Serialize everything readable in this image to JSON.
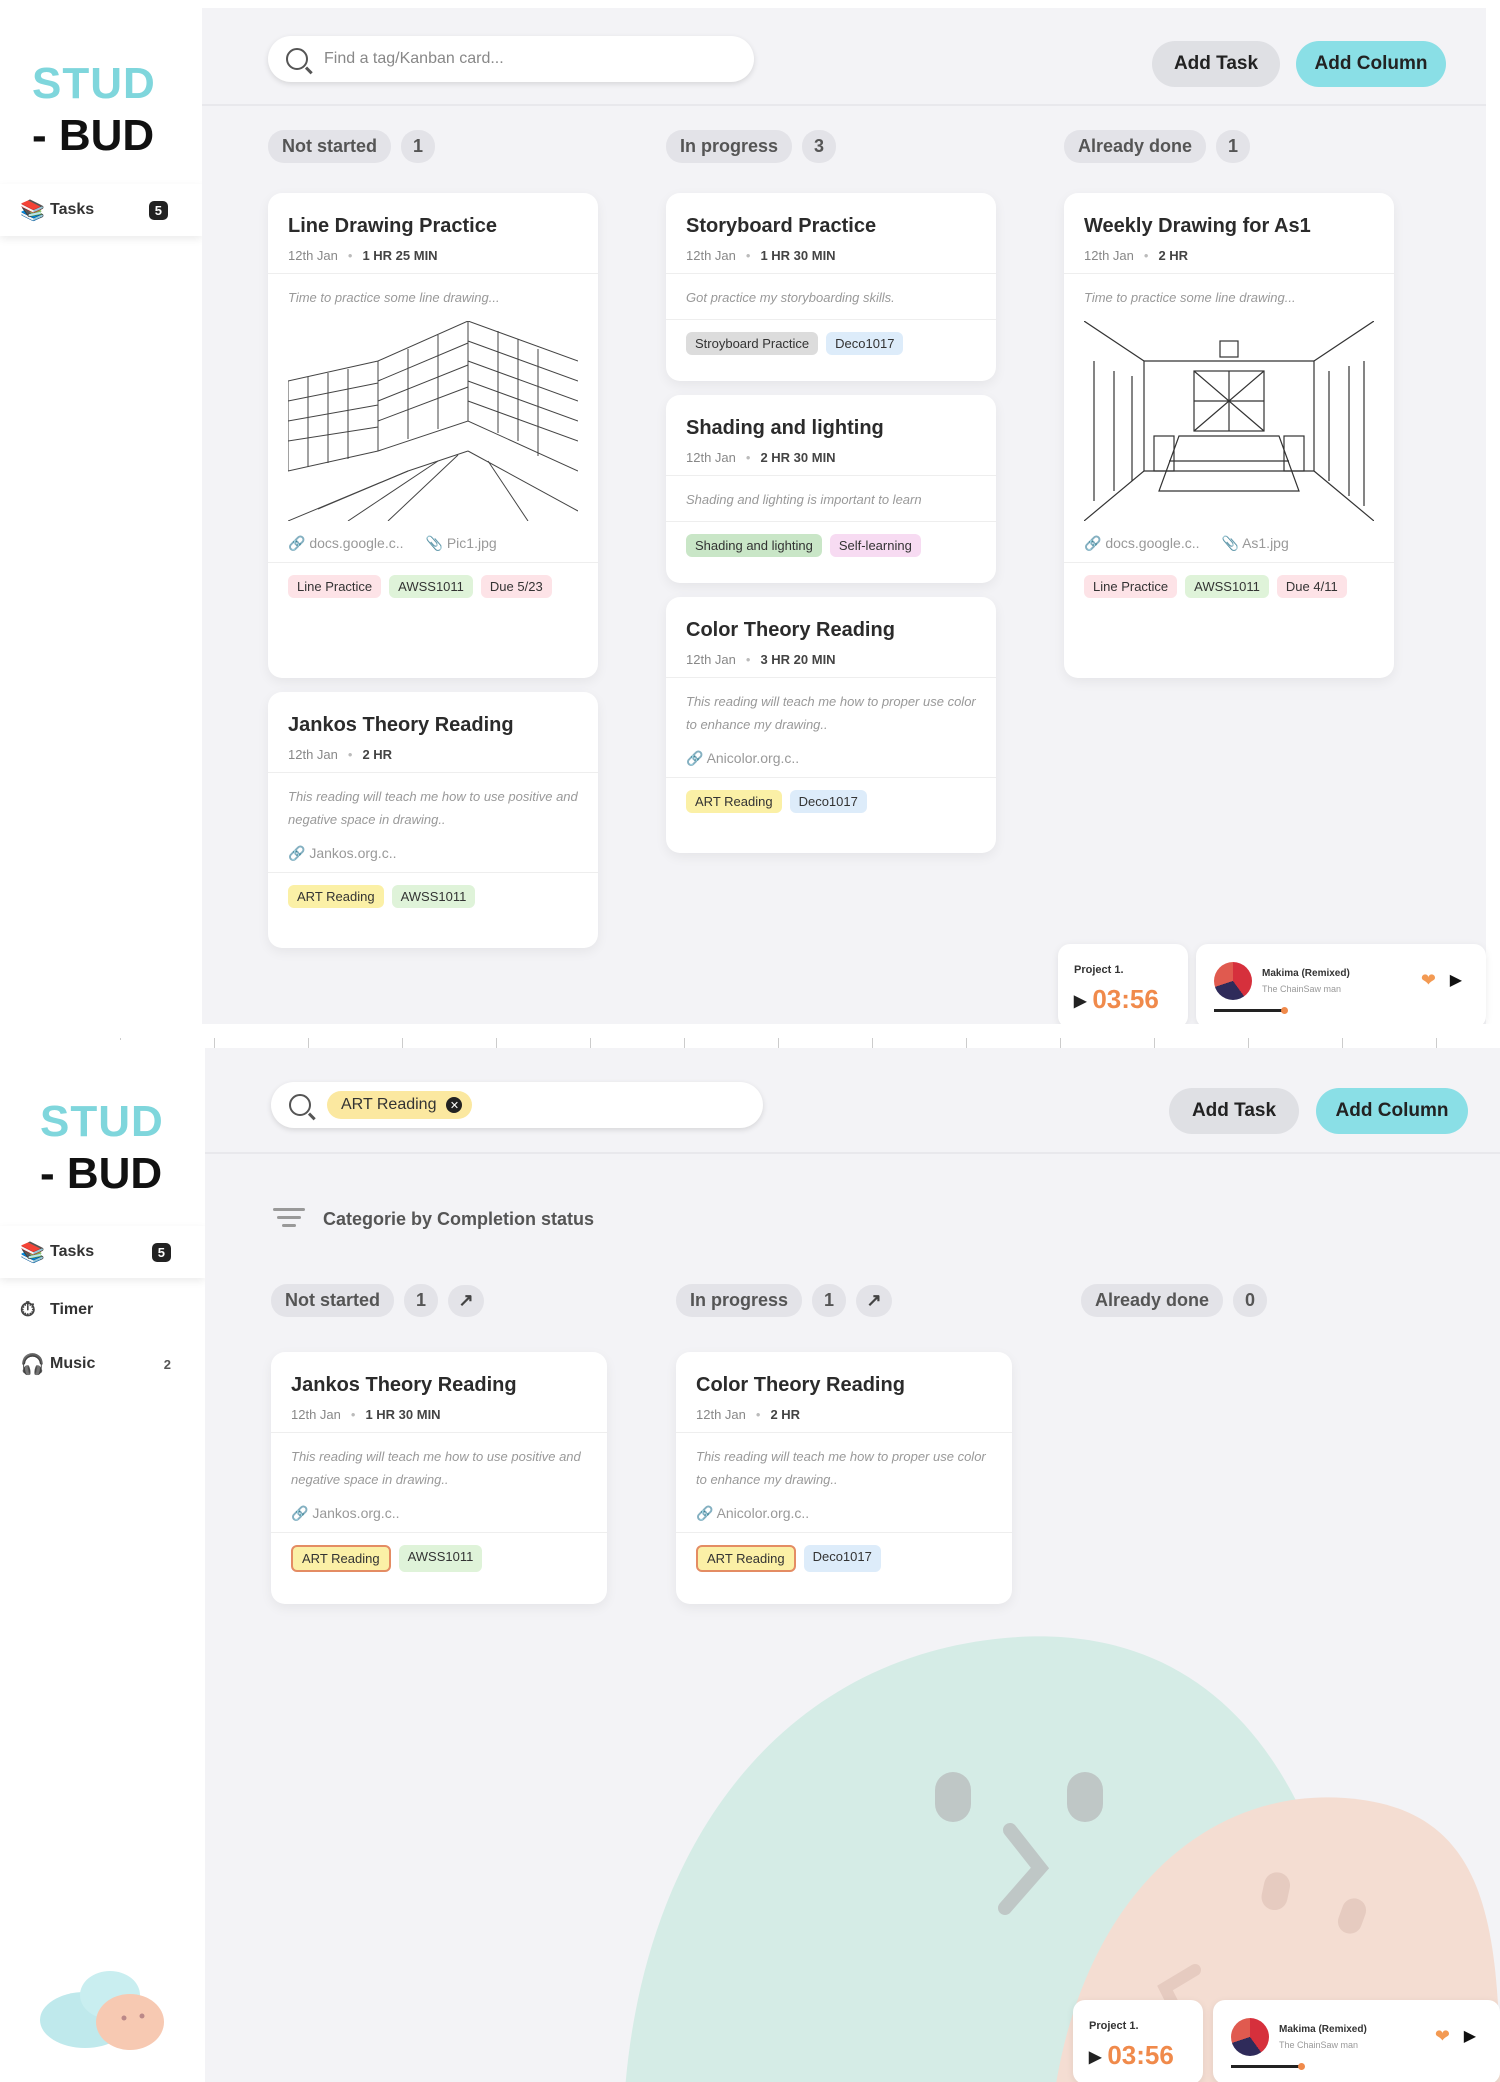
{
  "app": {
    "logo_top": "STUD",
    "logo_bottom": "- BUD"
  },
  "screen1": {
    "search": {
      "placeholder": "Find a tag/Kanban card..."
    },
    "buttons": {
      "add_task": "Add Task",
      "add_column": "Add Column"
    },
    "sidebar": {
      "items": [
        {
          "label": "Tasks",
          "count": "5",
          "icon": "books-icon"
        }
      ]
    },
    "columns": [
      {
        "label": "Not started",
        "count": "1"
      },
      {
        "label": "In progress",
        "count": "3"
      },
      {
        "label": "Already done",
        "count": "1"
      }
    ],
    "cards": {
      "line_drawing": {
        "title": "Line Drawing Practice",
        "date": "12th Jan",
        "duration": "1 HR 25 MIN",
        "desc": "Time to practice some line drawing...",
        "link": "docs.google.c..",
        "file": "Pic1.jpg",
        "tags": [
          "Line Practice",
          "AWSS1011",
          "Due 5/23"
        ]
      },
      "jankos": {
        "title": "Jankos Theory Reading",
        "date": "12th Jan",
        "duration": "2 HR",
        "desc": "This reading will teach me how to use positive and negative space in drawing..",
        "link": "Jankos.org.c..",
        "tags": [
          "ART Reading",
          "AWSS1011"
        ]
      },
      "storyboard": {
        "title": "Storyboard Practice",
        "date": "12th Jan",
        "duration": "1 HR 30 MIN",
        "desc": "Got practice my storyboarding skills.",
        "tags": [
          "Stroyboard Practice",
          "Deco1017"
        ]
      },
      "shading": {
        "title": "Shading and lighting",
        "date": "12th Jan",
        "duration": "2 HR 30 MIN",
        "desc": "Shading and lighting is important to learn",
        "tags": [
          "Shading and lighting",
          "Self-learning"
        ]
      },
      "color": {
        "title": "Color Theory Reading",
        "date": "12th Jan",
        "duration": "3 HR 20 MIN",
        "desc": "This reading will teach me how to proper use color to enhance my drawing..",
        "link": "Anicolor.org.c..",
        "tags": [
          "ART Reading",
          "Deco1017"
        ]
      },
      "weekly": {
        "title": "Weekly Drawing for As1",
        "date": "12th Jan",
        "duration": "2 HR",
        "desc": "Time to practice some line drawing...",
        "link": "docs.google.c..",
        "file": "As1.jpg",
        "tags": [
          "Line Practice",
          "AWSS1011",
          "Due 4/11"
        ]
      }
    },
    "timer": {
      "label": "Project 1.",
      "time": "03:56"
    },
    "music": {
      "song": "Makima (Remixed)",
      "artist": "The ChainSaw man"
    }
  },
  "screen2": {
    "search": {
      "chip": "ART Reading"
    },
    "buttons": {
      "add_task": "Add Task",
      "add_column": "Add Column"
    },
    "sidebar": {
      "items": [
        {
          "label": "Tasks",
          "count": "5",
          "icon": "books-icon"
        },
        {
          "label": "Timer",
          "count": "",
          "icon": "timer-icon"
        },
        {
          "label": "Music",
          "count": "2",
          "icon": "music-icon"
        }
      ]
    },
    "filter_label": "Categorie by Completion status",
    "columns": [
      {
        "label": "Not started",
        "count": "1"
      },
      {
        "label": "In progress",
        "count": "1"
      },
      {
        "label": "Already done",
        "count": "0"
      }
    ],
    "cards": {
      "jankos": {
        "title": "Jankos Theory Reading",
        "date": "12th Jan",
        "duration": "1 HR 30 MIN",
        "desc": "This reading will teach me how to use positive and negative space in drawing..",
        "link": "Jankos.org.c..",
        "tags": [
          "ART Reading",
          "AWSS1011"
        ]
      },
      "color": {
        "title": "Color Theory Reading",
        "date": "12th Jan",
        "duration": "2 HR",
        "desc": "This reading will teach me how to proper use color to enhance my drawing..",
        "link": "Anicolor.org.c..",
        "tags": [
          "ART Reading",
          "Deco1017"
        ]
      }
    },
    "timer": {
      "label": "Project 1.",
      "time": "03:56"
    },
    "music": {
      "song": "Makima (Remixed)",
      "artist": "The ChainSaw man"
    }
  },
  "colors": {
    "accent_teal": "#8adfe6",
    "timer_orange": "#f08a4b",
    "logo_teal": "#7fd6dc"
  }
}
